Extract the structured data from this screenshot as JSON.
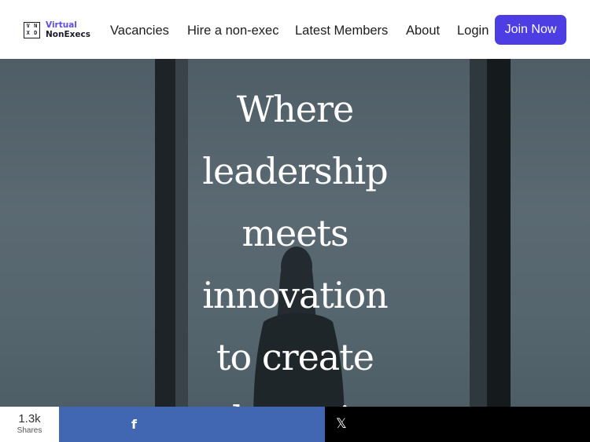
{
  "logo": {
    "mark": [
      "V",
      "N",
      "X",
      "D"
    ],
    "line1": "Virtual",
    "line2": "NonExecs"
  },
  "nav": {
    "items": [
      {
        "label": "Vacancies"
      },
      {
        "label": "Hire a non-exec"
      },
      {
        "label": "Latest Members"
      },
      {
        "label": "About"
      },
      {
        "label": "Login"
      }
    ],
    "join_label": "Join Now"
  },
  "hero": {
    "title_lines": [
      "Where",
      "leadership",
      "meets",
      "innovation",
      "to create",
      "dynamic"
    ]
  },
  "share": {
    "count": "1.3k",
    "count_label": "Shares",
    "facebook_icon": "f",
    "x_icon": "𝕏"
  },
  "colors": {
    "accent": "#4d3ee3",
    "facebook": "#4166b2",
    "x": "#000000"
  }
}
